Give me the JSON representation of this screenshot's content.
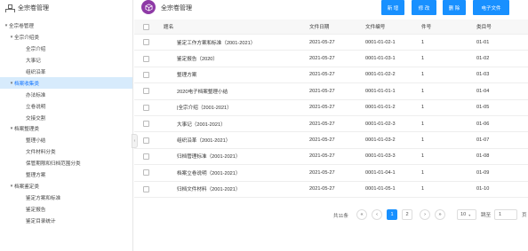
{
  "sidebar": {
    "title": "全宗卷管理",
    "tree": [
      {
        "label": "全宗卷管理",
        "level": 0,
        "arrow": "▾",
        "selected": false
      },
      {
        "label": "全宗介绍类",
        "level": 1,
        "arrow": "▾",
        "selected": false
      },
      {
        "label": "全宗介绍",
        "level": 2,
        "arrow": "",
        "selected": false
      },
      {
        "label": "大事记",
        "level": 2,
        "arrow": "",
        "selected": false
      },
      {
        "label": "组织沿革",
        "level": 2,
        "arrow": "",
        "selected": false
      },
      {
        "label": "档案收集类",
        "level": 1,
        "arrow": "▾",
        "selected": true
      },
      {
        "label": "办法标准",
        "level": 2,
        "arrow": "",
        "selected": false
      },
      {
        "label": "立卷说明",
        "level": 2,
        "arrow": "",
        "selected": false
      },
      {
        "label": "交接交割",
        "level": 2,
        "arrow": "",
        "selected": false
      },
      {
        "label": "档案整理类",
        "level": 1,
        "arrow": "▾",
        "selected": false
      },
      {
        "label": "整理小结",
        "level": 2,
        "arrow": "",
        "selected": false
      },
      {
        "label": "文件材料分类",
        "level": 2,
        "arrow": "",
        "selected": false
      },
      {
        "label": "保管期限和归档范围分类",
        "level": 2,
        "arrow": "",
        "selected": false
      },
      {
        "label": "整理方案",
        "level": 2,
        "arrow": "",
        "selected": false
      },
      {
        "label": "档案鉴定类",
        "level": 1,
        "arrow": "▾",
        "selected": false
      },
      {
        "label": "鉴定方案和标准",
        "level": 2,
        "arrow": "",
        "selected": false
      },
      {
        "label": "鉴定报告",
        "level": 2,
        "arrow": "",
        "selected": false
      },
      {
        "label": "鉴定目录统计",
        "level": 2,
        "arrow": "",
        "selected": false
      }
    ]
  },
  "collapse_arrow": "‹",
  "header": {
    "title": "全宗卷管理",
    "buttons": [
      "新 增",
      "修 改",
      "删 除",
      "电子文件"
    ]
  },
  "table": {
    "columns": [
      "题名",
      "文件日期",
      "文件编号",
      "件号",
      "类目号"
    ],
    "rows": [
      [
        "鉴定工作方案和标准（2001-2021）",
        "2021-05-27",
        "0001-01-02-1",
        "1",
        "01-01"
      ],
      [
        "鉴定报告（2020）",
        "2021-05-27",
        "0001-01-03-1",
        "1",
        "01-02"
      ],
      [
        "整理方案",
        "2021-05-27",
        "0001-01-02-2",
        "1",
        "01-03"
      ],
      [
        "2020电子档案整理小结",
        "2021-05-27",
        "0001-01-01-1",
        "1",
        "01-04"
      ],
      [
        "|全宗介绍（2001-2021）",
        "2021-05-27",
        "0001-01-01-2",
        "1",
        "01-05"
      ],
      [
        "大事记（2001-2021）",
        "2021-05-27",
        "0001-01-02-3",
        "1",
        "01-06"
      ],
      [
        "组织沿革（2001-2021）",
        "2021-05-27",
        "0001-01-03-2",
        "1",
        "01-07"
      ],
      [
        "归档管理标准（2001-2021）",
        "2021-05-27",
        "0001-01-03-3",
        "1",
        "01-08"
      ],
      [
        "档案立卷说明（2001-2021）",
        "2021-05-27",
        "0001-01-04-1",
        "1",
        "01-09"
      ],
      [
        "归档文件材料（2001-2021）",
        "2021-05-27",
        "0001-01-05-1",
        "1",
        "01-10"
      ]
    ]
  },
  "pagination": {
    "total": "共11条",
    "first": "«",
    "prev": "‹",
    "pages": [
      "1",
      "2"
    ],
    "next": "›",
    "last": "»",
    "page_size": "10",
    "goto_label": "跳至",
    "goto_value": "1",
    "page_suffix": "页"
  },
  "colors": {
    "accent": "#1890ff",
    "logo": "#8e3aa6",
    "selected_bg": "#d7ebfc"
  }
}
